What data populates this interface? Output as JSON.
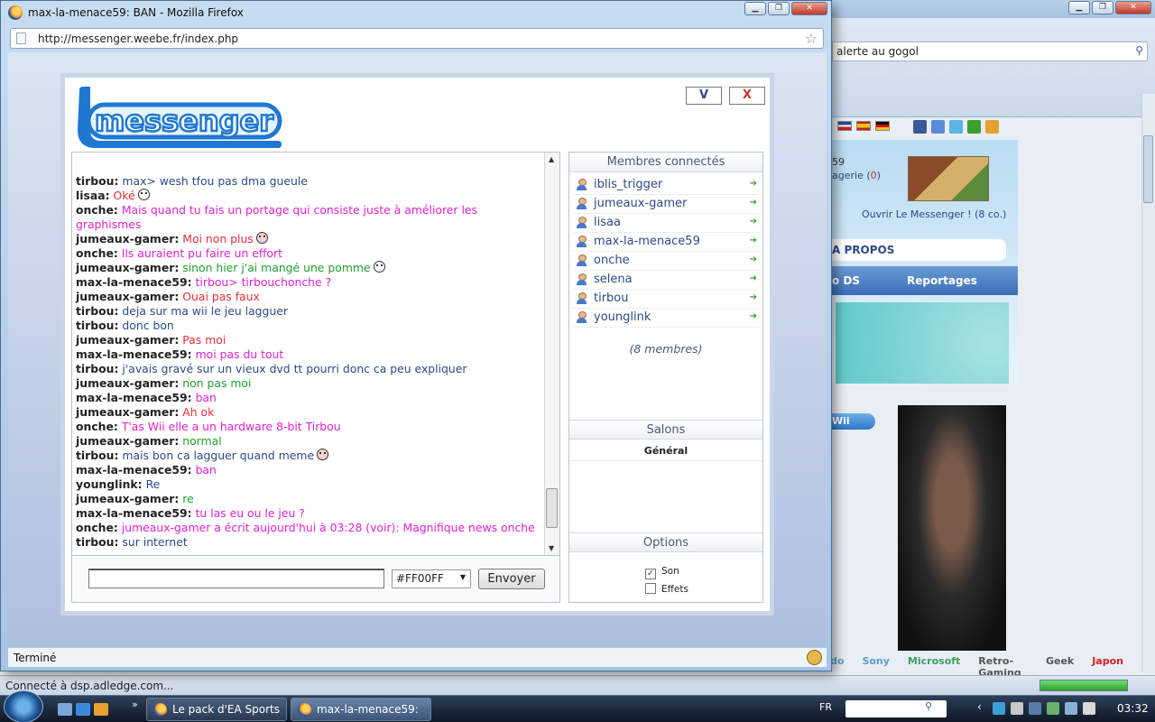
{
  "window": {
    "title": "max-la-menace59: BAN - Mozilla Firefox",
    "url": "http://messenger.weebe.fr/index.php",
    "status": "Terminé"
  },
  "background_browser": {
    "search_value": "alerte au gogol",
    "profile_number": "59",
    "profile_messages_label": "agerie (",
    "profile_messages_count": "0",
    "profile_messages_close": ")",
    "open_messenger": "Ouvrir Le Messenger ! (8 co.)",
    "apropos": "A PROPOS",
    "nav_items": [
      "o DS",
      "Reportages"
    ],
    "wii_label": "Wii",
    "categories": [
      {
        "label": "do",
        "color": "#5aa0c8"
      },
      {
        "label": "Sony",
        "color": "#5aa0c8"
      },
      {
        "label": "Microsoft",
        "color": "#3aa060"
      },
      {
        "label": "Retro-Gaming",
        "color": "#555555"
      },
      {
        "label": "Geek",
        "color": "#555555"
      },
      {
        "label": "Japon",
        "color": "#d02020"
      }
    ],
    "status_text": "Connecté à dsp.adledge.com...",
    "progress": 1.0
  },
  "messenger": {
    "logo_text": "messenger",
    "btn_v": "V",
    "btn_x": "X",
    "chat": [
      {
        "nick": "tirbou:",
        "msg": "max> wesh tfou pas dma gueule",
        "cls": "c-tirbou",
        "smiley": ""
      },
      {
        "nick": "lisaa:",
        "msg": "Oké",
        "cls": "c-lisaa",
        "smiley": "happy"
      },
      {
        "nick": "onche:",
        "msg": "Mais quand tu fais un portage qui consiste juste à améliorer les graphismes",
        "cls": "c-onche",
        "smiley": ""
      },
      {
        "nick": "jumeaux-gamer:",
        "msg": "Moi non plus",
        "cls": "c-jum-red",
        "smiley": "mad"
      },
      {
        "nick": "onche:",
        "msg": "Ils auraient pu faire un effort",
        "cls": "c-onche",
        "smiley": ""
      },
      {
        "nick": "jumeaux-gamer:",
        "msg": "sinon hier j'ai mangé une pomme",
        "cls": "c-jum-green",
        "smiley": "happy"
      },
      {
        "nick": "max-la-menace59:",
        "msg": "tirbou> tirbouchonche ?",
        "cls": "c-maxm",
        "smiley": ""
      },
      {
        "nick": "jumeaux-gamer:",
        "msg": "Ouai pas faux",
        "cls": "c-jum-red",
        "smiley": ""
      },
      {
        "nick": "tirbou:",
        "msg": "deja sur ma wii le jeu lagguer",
        "cls": "c-tirbou",
        "smiley": ""
      },
      {
        "nick": "tirbou:",
        "msg": "donc bon",
        "cls": "c-tirbou",
        "smiley": ""
      },
      {
        "nick": "jumeaux-gamer:",
        "msg": "Pas moi",
        "cls": "c-jum-red",
        "smiley": ""
      },
      {
        "nick": "max-la-menace59:",
        "msg": "moi pas du tout",
        "cls": "c-maxm",
        "smiley": ""
      },
      {
        "nick": "tirbou:",
        "msg": "j'avais gravé sur un vieux dvd tt pourri donc ca peu expliquer",
        "cls": "c-tirbou",
        "smiley": ""
      },
      {
        "nick": "jumeaux-gamer:",
        "msg": "non pas moi",
        "cls": "c-jum-green",
        "smiley": ""
      },
      {
        "nick": "max-la-menace59:",
        "msg": "ban",
        "cls": "c-maxm",
        "smiley": ""
      },
      {
        "nick": "jumeaux-gamer:",
        "msg": "Ah ok",
        "cls": "c-jum-red",
        "smiley": ""
      },
      {
        "nick": "onche:",
        "msg": "T'as Wii elle a un hardware 8-bit Tirbou",
        "cls": "c-onche",
        "smiley": ""
      },
      {
        "nick": "jumeaux-gamer:",
        "msg": "normal",
        "cls": "c-jum-green",
        "smiley": ""
      },
      {
        "nick": "tirbou:",
        "msg": "mais bon ca lagguer quand meme",
        "cls": "c-tirbou",
        "smiley": "mad"
      },
      {
        "nick": "max-la-menace59:",
        "msg": "ban",
        "cls": "c-maxm",
        "smiley": ""
      },
      {
        "nick": "younglink:",
        "msg": "Re",
        "cls": "c-young",
        "smiley": ""
      },
      {
        "nick": "jumeaux-gamer:",
        "msg": "re",
        "cls": "c-jum-green",
        "smiley": ""
      },
      {
        "nick": "max-la-menace59:",
        "msg": "tu las eu ou le jeu ?",
        "cls": "c-maxm",
        "smiley": ""
      },
      {
        "nick": "onche:",
        "msg": "jumeaux-gamer a écrit aujourd'hui à 03:28 (voir): Magnifique news onche",
        "cls": "c-onche",
        "smiley": ""
      },
      {
        "nick": "tirbou:",
        "msg": "sur internet",
        "cls": "c-tirbou",
        "smiley": ""
      }
    ],
    "input_value": "",
    "color_value": "#FF00FF",
    "send_label": "Envoyer",
    "members_title": "Membres connectés",
    "members": [
      "iblis_trigger",
      "jumeaux-gamer",
      "lisaa",
      "max-la-menace59",
      "onche",
      "selena",
      "tirbou",
      "younglink"
    ],
    "members_count": "(8 membres)",
    "salons_title": "Salons",
    "salon_general": "Général",
    "options_title": "Options",
    "option_son": "Son",
    "option_son_checked": true,
    "option_effets": "Effets",
    "option_effets_checked": false
  },
  "taskbar": {
    "tasks": [
      "Le pack d'EA Sports ...",
      "max-la-menace59: ..."
    ],
    "lang": "FR",
    "clock": "03:32"
  }
}
